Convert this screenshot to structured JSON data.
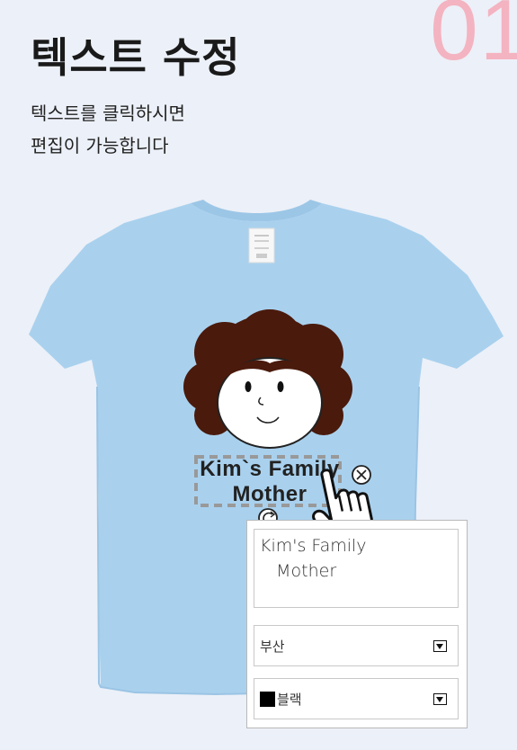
{
  "step": "01",
  "title": "텍스트 수정",
  "description": [
    "텍스트를 클릭하시면",
    "편집이 가능합니다"
  ],
  "product": {
    "shirt_color": "#a9d1ee",
    "hair_color": "#4a1a0c",
    "print_text": [
      "Kim`s Family",
      "Mother"
    ]
  },
  "editor": {
    "text_value": "Kim's Family\n   Mother",
    "font": "부산",
    "color_name": "블랙",
    "color_hex": "#000000",
    "font_dropdown_icon": "dropdown-arrow",
    "color_dropdown_icon": "dropdown-arrow"
  },
  "icons": [
    "close-icon",
    "rotate-icon",
    "hand-pointer-icon",
    "arrow-down-icon"
  ]
}
